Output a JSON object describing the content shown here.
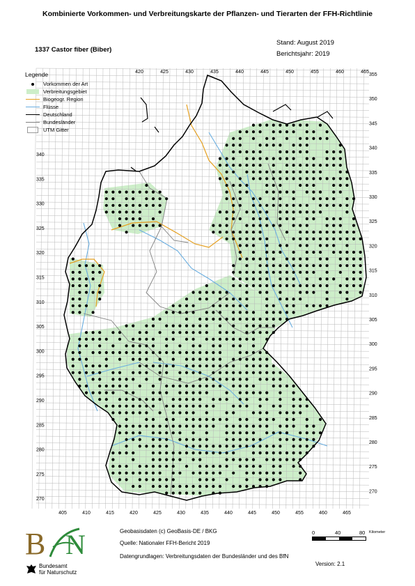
{
  "header": {
    "title": "Kombinierte Vorkommen- und Verbreitungskarte der Pflanzen- und Tierarten der FFH-Richtlinie",
    "species": "1337 Castor fiber (Biber)",
    "stand": "Stand: August 2019",
    "berichtsjahr": "Berichtsjahr: 2019"
  },
  "legend": {
    "title": "Legende",
    "items": [
      {
        "label": "Vorkommen der Art",
        "symbol": "dot",
        "color": "#000000"
      },
      {
        "label": "Verbreitungsgebiet",
        "symbol": "fill",
        "color": "#cdeec9"
      },
      {
        "label": "Biogeogr. Region",
        "symbol": "line",
        "color": "#e5a020"
      },
      {
        "label": "Flüsse",
        "symbol": "line",
        "color": "#6aaee0"
      },
      {
        "label": "Deutschland",
        "symbol": "line",
        "color": "#000000"
      },
      {
        "label": "Bundesländer",
        "symbol": "line",
        "color": "#808080"
      },
      {
        "label": "UTM Gitter",
        "symbol": "box",
        "color": "#999999"
      }
    ]
  },
  "grid_labels": {
    "top": [
      "420",
      "425",
      "430",
      "435",
      "440",
      "445",
      "450",
      "455",
      "460",
      "465"
    ],
    "bottom": [
      "405",
      "410",
      "415",
      "420",
      "425",
      "430",
      "435",
      "440",
      "445",
      "450",
      "455",
      "460",
      "465"
    ],
    "left": [
      "340",
      "335",
      "330",
      "325",
      "320",
      "315",
      "310",
      "305",
      "300",
      "295",
      "290",
      "285",
      "280",
      "275",
      "270"
    ],
    "right": [
      "355",
      "350",
      "345",
      "340",
      "335",
      "330",
      "325",
      "320",
      "315",
      "310",
      "305",
      "300",
      "295",
      "290",
      "285",
      "280",
      "275",
      "270"
    ]
  },
  "colors": {
    "range_fill": "#cdeec9",
    "grid": "#b8b8b8",
    "river": "#6aaee0",
    "bio_region": "#e5a020",
    "state_border": "#808080",
    "country_border": "#000000",
    "occurrence_dot": "#000000"
  },
  "scalebar": {
    "ticks": [
      "0",
      "40",
      "80"
    ],
    "unit": "Kilometer"
  },
  "footer": {
    "geodata": "Geobasisdaten (c) GeoBasis-DE / BKG",
    "source": "Quelle: Nationaler FFH-Bericht 2019",
    "basis": "Datengrundlagen: Verbreitungsdaten der Bundesländer und des BfN",
    "version": "Version: 2.1"
  },
  "logo": {
    "name_line1": "Bundesamt",
    "name_line2": "für Naturschutz"
  }
}
